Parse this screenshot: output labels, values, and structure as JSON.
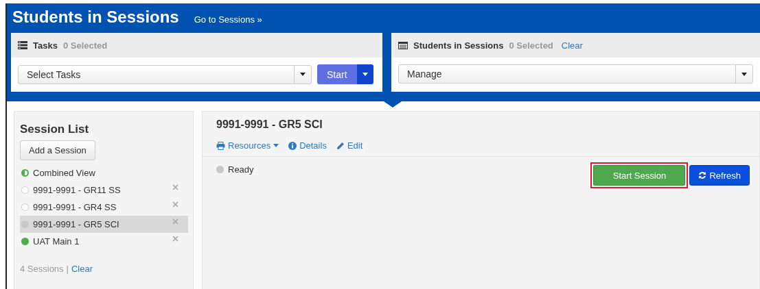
{
  "header": {
    "title": "Students in Sessions",
    "link": "Go to Sessions »"
  },
  "tasks_panel": {
    "title": "Tasks",
    "count": "0 Selected",
    "select": {
      "value": "Select Tasks"
    },
    "start_button": "Start"
  },
  "students_panel": {
    "title": "Students in Sessions",
    "count": "0 Selected",
    "clear_link": "Clear",
    "select": {
      "value": "Manage"
    }
  },
  "session_list": {
    "title": "Session List",
    "add_button": "Add a Session",
    "items": [
      {
        "label": "Combined View",
        "kind": "combined",
        "selected": false,
        "removable": false
      },
      {
        "label": "9991-9991 - GR11 SS",
        "kind": "unstarted",
        "selected": false,
        "removable": true
      },
      {
        "label": "9991-9991 - GR4 SS",
        "kind": "unstarted",
        "selected": false,
        "removable": true
      },
      {
        "label": "9991-9991 - GR5 SCI",
        "kind": "ready",
        "selected": true,
        "removable": true
      },
      {
        "label": "UAT Main 1",
        "kind": "active",
        "selected": false,
        "removable": true
      }
    ],
    "footer_count": "4 Sessions",
    "footer_separator": "|",
    "footer_clear": "Clear"
  },
  "session": {
    "title": "9991-9991 - GR5 SCI",
    "links": [
      {
        "kind": "resources",
        "label": "Resources"
      },
      {
        "kind": "details",
        "label": "Details"
      },
      {
        "kind": "edit",
        "label": "Edit"
      }
    ],
    "status": {
      "label": "Ready",
      "kind": "ready"
    },
    "start_button": {
      "label": "Start Session",
      "highlighted": true
    },
    "refresh_button": "Refresh"
  }
}
